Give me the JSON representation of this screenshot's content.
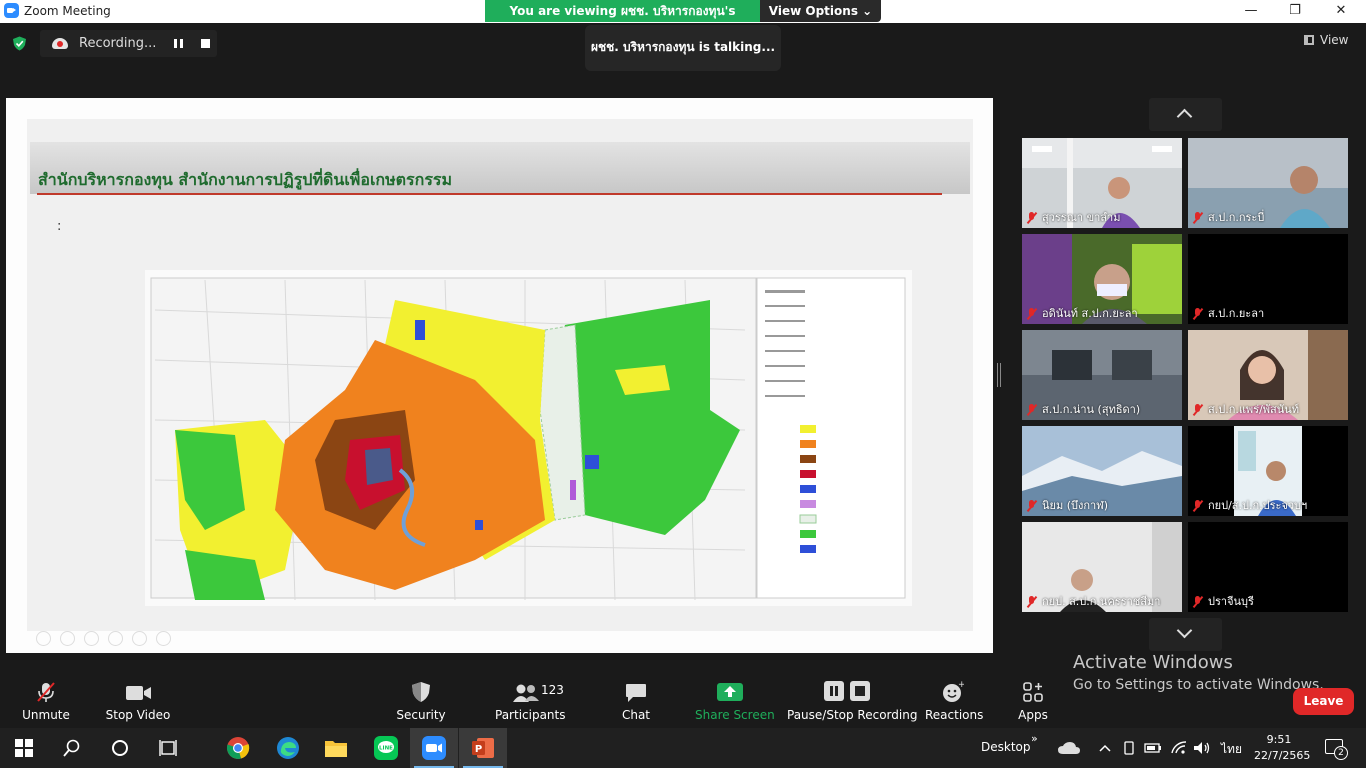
{
  "window": {
    "title": "Zoom Meeting",
    "minimize": "—",
    "maximize": "❐",
    "close": "✕"
  },
  "banner": {
    "viewing": "You are viewing ผชช. บริหารกองทุน's screen",
    "view_options": "View Options ⌄"
  },
  "recording": {
    "label": "Recording..."
  },
  "talking": "ผชช. บริหารกองทุน is  talking...",
  "view_button": "View",
  "slide": {
    "title": "สำนักบริหารกองทุน สำนักงานการปฏิรูปที่ดินเพื่อเกษตรกรรม",
    "colon": ":"
  },
  "participants": [
    {
      "name": "สุวรรณา ขาลำม"
    },
    {
      "name": "ส.ป.ก.กระบี่"
    },
    {
      "name": "อดินันท์ ส.ป.ก.ยะลา"
    },
    {
      "name": "ส.ป.ก.ยะลา"
    },
    {
      "name": "ส.ป.ก.น่าน (สุทธิดา)"
    },
    {
      "name": "ส.ป.ก.แพร่/พัสนันท์"
    },
    {
      "name": "นิยม (บึงกาฬ)"
    },
    {
      "name": "กยป/ส.ป.ก.ประจวบฯ"
    },
    {
      "name": "กยป. ส.ป.ก.นครราชสีมา"
    },
    {
      "name": "ปราจีนบุรี"
    }
  ],
  "toolbar": {
    "unmute": "Unmute",
    "stop_video": "Stop Video",
    "security": "Security",
    "participants": "Participants",
    "participants_count": "123",
    "chat": "Chat",
    "share_screen": "Share Screen",
    "pause_stop_recording": "Pause/Stop Recording",
    "reactions": "Reactions",
    "apps": "Apps",
    "leave": "Leave"
  },
  "activate": {
    "line1": "Activate Windows",
    "line2": "Go to Settings to activate Windows."
  },
  "taskbar": {
    "desktop": "Desktop",
    "chevron": "»",
    "language": "ไทย",
    "time": "9:51",
    "date": "22/7/2565",
    "notifications": "2"
  },
  "colors": {
    "banner_green": "#1fae5b",
    "leave_red": "#e02828",
    "share_green": "#1fae5b",
    "taskbar": "#202020"
  }
}
